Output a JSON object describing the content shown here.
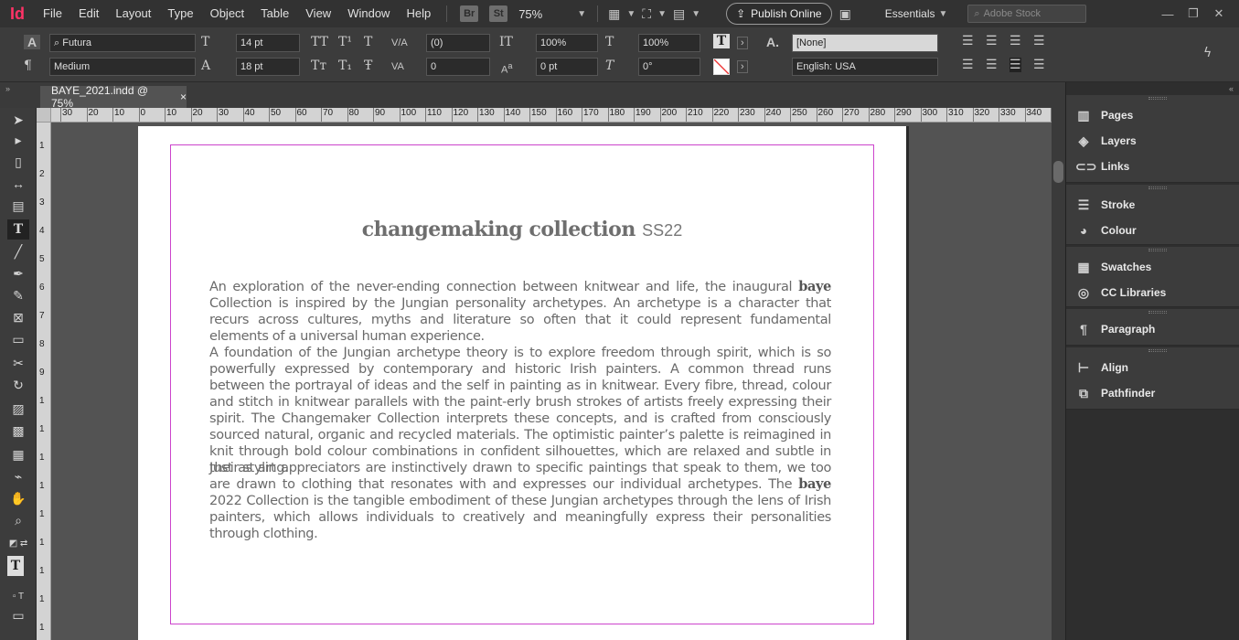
{
  "app": {
    "logo": "Id",
    "title": "BAYE_2021.indd @ 75%"
  },
  "menu": [
    "File",
    "Edit",
    "Layout",
    "Type",
    "Object",
    "Table",
    "View",
    "Window",
    "Help"
  ],
  "menubar": {
    "bridge_badge": "Br",
    "stock_badge": "St",
    "zoom": "75%",
    "publish_label": "Publish Online",
    "workspace": "Essentials",
    "stock_placeholder": "Adobe Stock"
  },
  "control": {
    "font_family": "Futura",
    "font_style": "Medium",
    "font_size": "14 pt",
    "leading": "18 pt",
    "kerning": "(0)",
    "tracking": "0",
    "vscale": "100%",
    "hscale": "100%",
    "baseline": "0 pt",
    "skew": "0°",
    "char_style": "[None]",
    "language": "English: USA"
  },
  "tab": {
    "label": "BAYE_2021.indd @ 75%",
    "close": "×"
  },
  "ruler": {
    "h_ticks": [
      "30",
      "20",
      "10",
      "0",
      "10",
      "20",
      "30",
      "40",
      "50",
      "60",
      "70",
      "80",
      "90",
      "100",
      "110",
      "120",
      "130",
      "140",
      "150",
      "160",
      "170",
      "180",
      "190",
      "200",
      "210",
      "220",
      "230",
      "240",
      "250",
      "260",
      "270",
      "280",
      "290",
      "300",
      "310",
      "320",
      "330",
      "340",
      "3"
    ],
    "v_ticks": [
      "1",
      "2",
      "3",
      "4",
      "5",
      "6",
      "7",
      "8",
      "9",
      "1",
      "1",
      "1",
      "1",
      "1",
      "1",
      "1",
      "1",
      "1"
    ]
  },
  "document": {
    "title_main": "changemaking collection",
    "title_sub": "SS22",
    "para1_a": "An exploration of the never-ending connection between knitwear and life, the inaugural ",
    "para1_brand": "baye",
    "para1_b": " Collection is inspired by the Jungian personality archetypes. An archetype is a character that recurs across cultures, myths and literature so often that it could represent fundamental elements of a universal human experience.",
    "para2": "A foundation of the Jungian archetype theory is to explore freedom through spirit, which is so powerfully expressed by contemporary and historic Irish painters. A common thread runs between the portrayal of ideas and the self in painting as in knitwear. Every fibre, thread, colour and stitch in knitwear parallels with the paint-erly brush strokes of artists freely expressing their spirit. The Changemaker Collection interprets these concepts, and is crafted from consciously sourced natural, organic and recycled materials. The optimistic painter’s palette is reimagined in knit through bold colour combinations in confident silhouettes, which are relaxed and subtle in their styling.",
    "para3_a": "Just as art appreciators are instinctively drawn to specific paintings that speak to them, we too are drawn to clothing that resonates with and expresses our individual archetypes. The ",
    "para3_brand": "baye",
    "para3_b": " 2022 Collection is the tangible embodiment of these Jungian archetypes through the lens of Irish painters, which allows individuals to creatively and meaningfully express their personalities through clothing."
  },
  "panels": {
    "pages": "Pages",
    "layers": "Layers",
    "links": "Links",
    "stroke": "Stroke",
    "colour": "Colour",
    "swatches": "Swatches",
    "cc_libraries": "CC Libraries",
    "paragraph": "Paragraph",
    "align": "Align",
    "pathfinder": "Pathfinder"
  },
  "colors": {
    "accent": "#ff3366",
    "margin_guide": "#cc44cc",
    "panel_bg": "#3c3c3c"
  }
}
